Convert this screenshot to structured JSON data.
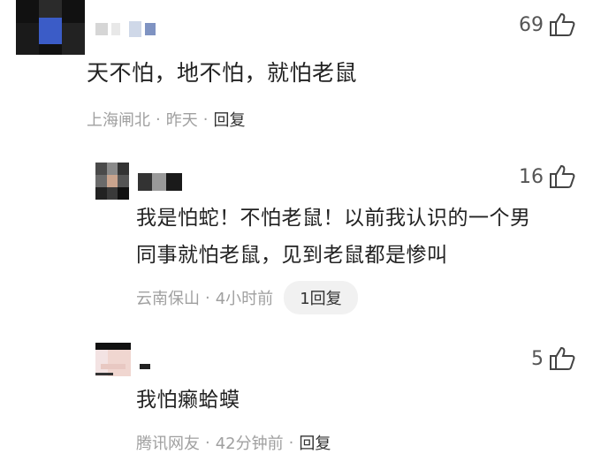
{
  "comments": [
    {
      "likes": "69",
      "text": "天不怕，地不怕，就怕老鼠",
      "location": "上海闸北",
      "time": "昨天",
      "reply_label": "回复"
    },
    {
      "likes": "16",
      "text_line1": "我是怕蛇！不怕老鼠！以前我认识的一个男",
      "text_line2": "同事就怕老鼠，见到老鼠都是惨叫",
      "location": "云南保山",
      "time": "4小时前",
      "reply_count_label": "1回复"
    },
    {
      "likes": "5",
      "text": "我怕癞蛤蟆",
      "location": "腾讯网友",
      "time": "42分钟前",
      "reply_label": "回复"
    }
  ],
  "separator": "·",
  "icons": {
    "like": "thumbs-up-icon"
  },
  "colors": {
    "meta_text": "#a0a0a0",
    "pill_bg": "#f1f1f1"
  }
}
